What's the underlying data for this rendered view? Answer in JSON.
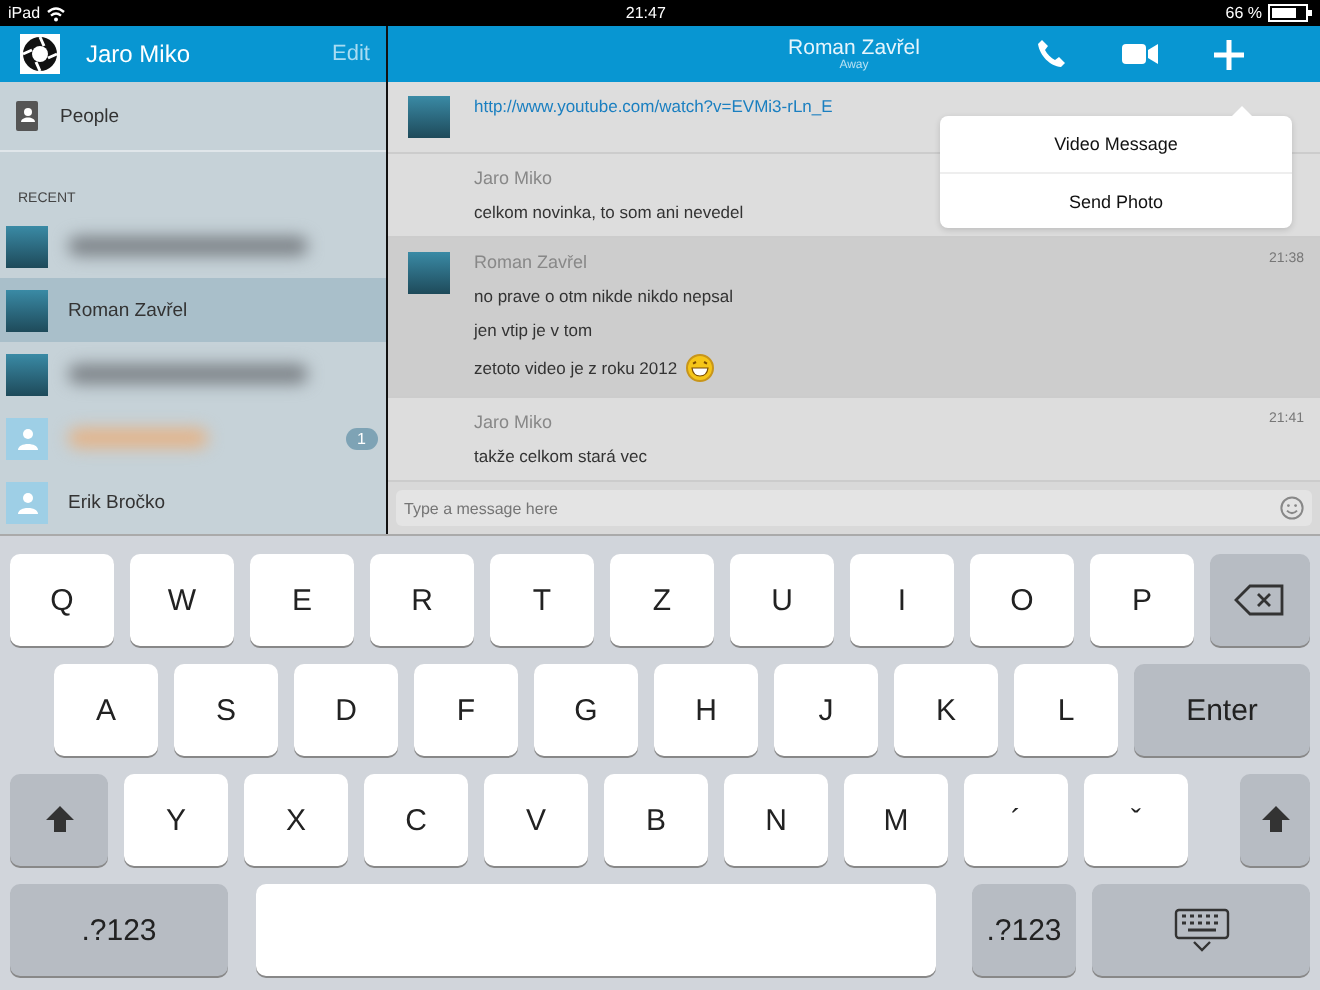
{
  "status_bar": {
    "device": "iPad",
    "time": "21:47",
    "battery": "66 %"
  },
  "sidebar": {
    "user": "Jaro Miko",
    "edit": "Edit",
    "people": "People",
    "section": "RECENT",
    "contacts": [
      {
        "kind": "blurred",
        "photo": true,
        "selected": false
      },
      {
        "kind": "named",
        "name": "Roman Zavřel",
        "photo": true,
        "selected": true
      },
      {
        "kind": "blurred",
        "photo": true,
        "selected": false
      },
      {
        "kind": "blurred",
        "photo": false,
        "selected": false,
        "badge": "1"
      },
      {
        "kind": "named",
        "name": "Erik Bročko",
        "photo": false,
        "selected": false
      }
    ]
  },
  "chat": {
    "name": "Roman Zavřel",
    "status": "Away",
    "menu": [
      "Video Message",
      "Send Photo"
    ],
    "messages": [
      {
        "avatar": true,
        "highlighted": false,
        "lines": [
          {
            "text": "http://www.youtube.com/watch?v=EVMi3-rLn_E",
            "kind": "link"
          }
        ]
      },
      {
        "sender": "Jaro Miko",
        "avatar": false,
        "highlighted": false,
        "lines": [
          {
            "text": "celkom novinka, to som ani nevedel",
            "kind": "text"
          }
        ]
      },
      {
        "sender": "Roman Zavřel",
        "time": "21:38",
        "avatar": true,
        "highlighted": true,
        "lines": [
          {
            "text": "no prave o otm nikde nikdo nepsal",
            "kind": "text"
          },
          {
            "text": "jen vtip je v tom",
            "kind": "text"
          },
          {
            "text": "zetoto video je z roku 2012",
            "kind": "text",
            "emoji": true
          }
        ]
      },
      {
        "sender": "Jaro Miko",
        "time": "21:41",
        "avatar": false,
        "highlighted": false,
        "lines": [
          {
            "text": "takže celkom stará vec",
            "kind": "text"
          }
        ]
      }
    ],
    "input": {
      "placeholder": "Type a message here"
    }
  },
  "keyboard": {
    "rows": [
      {
        "keys": [
          {
            "kind": "char",
            "label": "Q"
          },
          {
            "kind": "char",
            "label": "W"
          },
          {
            "kind": "char",
            "label": "E"
          },
          {
            "kind": "char",
            "label": "R"
          },
          {
            "kind": "char",
            "label": "T"
          },
          {
            "kind": "char",
            "label": "Z"
          },
          {
            "kind": "char",
            "label": "U"
          },
          {
            "kind": "char",
            "label": "I"
          },
          {
            "kind": "char",
            "label": "O"
          },
          {
            "kind": "char",
            "label": "P"
          },
          {
            "kind": "backspace"
          }
        ]
      },
      {
        "keys": [
          {
            "kind": "char",
            "label": "A"
          },
          {
            "kind": "char",
            "label": "S"
          },
          {
            "kind": "char",
            "label": "D"
          },
          {
            "kind": "char",
            "label": "F"
          },
          {
            "kind": "char",
            "label": "G"
          },
          {
            "kind": "char",
            "label": "H"
          },
          {
            "kind": "char",
            "label": "J"
          },
          {
            "kind": "char",
            "label": "K"
          },
          {
            "kind": "char",
            "label": "L"
          },
          {
            "kind": "enter",
            "label": "Enter"
          }
        ]
      },
      {
        "keys": [
          {
            "kind": "shift"
          },
          {
            "kind": "char",
            "label": "Y"
          },
          {
            "kind": "char",
            "label": "X"
          },
          {
            "kind": "char",
            "label": "C"
          },
          {
            "kind": "char",
            "label": "V"
          },
          {
            "kind": "char",
            "label": "B"
          },
          {
            "kind": "char",
            "label": "N"
          },
          {
            "kind": "char",
            "label": "M"
          },
          {
            "kind": "char",
            "label": "´"
          },
          {
            "kind": "char",
            "label": "ˇ"
          },
          {
            "kind": "shift"
          }
        ]
      },
      {
        "keys": [
          {
            "kind": "mode",
            "label": ".?123"
          },
          {
            "kind": "space"
          },
          {
            "kind": "mode",
            "label": ".?123"
          },
          {
            "kind": "hide"
          }
        ]
      }
    ]
  }
}
